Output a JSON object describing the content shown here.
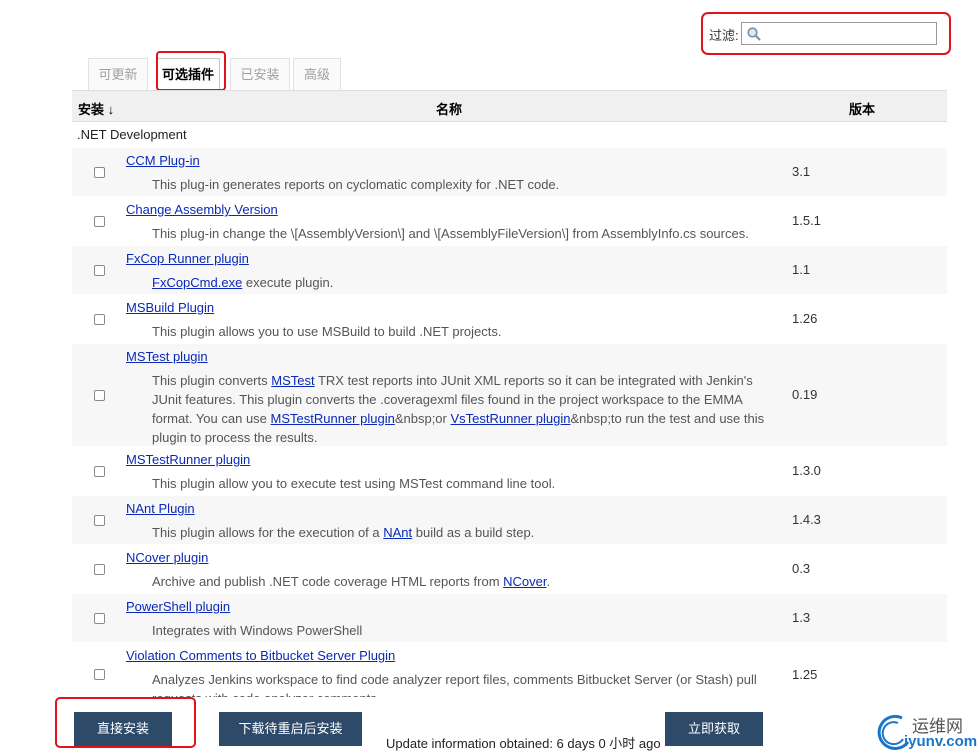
{
  "filter": {
    "label": "过滤:",
    "placeholder": ""
  },
  "tabs": [
    {
      "label": "可更新"
    },
    {
      "label": "可选插件"
    },
    {
      "label": "已安装"
    },
    {
      "label": "高级"
    }
  ],
  "table": {
    "col_install": "安装 ↓",
    "col_name": "名称",
    "col_version": "版本",
    "category": ".NET Development",
    "plugins": [
      {
        "name": "CCM Plug-in",
        "desc": "This plug-in generates reports on cyclomatic complexity for .NET code.",
        "version": "3.1"
      },
      {
        "name": "Change Assembly Version",
        "desc": "This plug-in change the \\[AssemblyVersion\\] and \\[AssemblyFileVersion\\] from AssemblyInfo.cs sources.",
        "version": "1.5.1"
      },
      {
        "name": "FxCop Runner plugin",
        "desc_link": "FxCopCmd.exe",
        "desc_rest": " execute plugin.",
        "version": "1.1"
      },
      {
        "name": "MSBuild Plugin",
        "desc": "This plugin allows you to use MSBuild to build .NET projects.",
        "version": "1.26"
      },
      {
        "name": "MSTest plugin",
        "desc_a": "This plugin converts ",
        "desc_link1": "MSTest",
        "desc_b": " TRX test reports into JUnit XML reports so it can be integrated with Jenkin's JUnit features. This plugin converts the .coveragexml files found in the project workspace to the EMMA format. You can use ",
        "desc_link2": "MSTestRunner plugin",
        "desc_c": "&nbsp;or ",
        "desc_link3": "VsTestRunner plugin",
        "desc_d": "&nbsp;to run the test and use this plugin to process the results.",
        "version": "0.19"
      },
      {
        "name": "MSTestRunner plugin",
        "desc": "This plugin allow you to execute test using MSTest command line tool.",
        "version": "1.3.0"
      },
      {
        "name": "NAnt Plugin",
        "desc_pre": "This plugin allows for the execution of a ",
        "desc_link": "NAnt",
        "desc_post": " build as a build step.",
        "version": "1.4.3"
      },
      {
        "name": "NCover plugin",
        "desc_pre": "Archive and publish .NET code coverage HTML reports from ",
        "desc_link": "NCover",
        "desc_post": ".",
        "version": "0.3"
      },
      {
        "name": "PowerShell plugin",
        "desc": "Integrates with Windows PowerShell",
        "version": "1.3"
      },
      {
        "name": "Violation Comments to Bitbucket Server Plugin",
        "desc": "Analyzes Jenkins workspace to find code analyzer report files, comments Bitbucket Server (or Stash) pull requests with code analyzer comments.",
        "version": "1.25"
      }
    ]
  },
  "bottom": {
    "install_now": "直接安装",
    "download_restart": "下载待重启后安装",
    "update_info": "Update information obtained: 6 days 0 小时 ago",
    "check_now": "立即获取"
  },
  "watermark": {
    "cn": "运维网",
    "en": "iyunv.com"
  },
  "colors": {
    "accent_red": "#e0131b",
    "button": "#2e4a69",
    "link": "#0a29b8"
  }
}
